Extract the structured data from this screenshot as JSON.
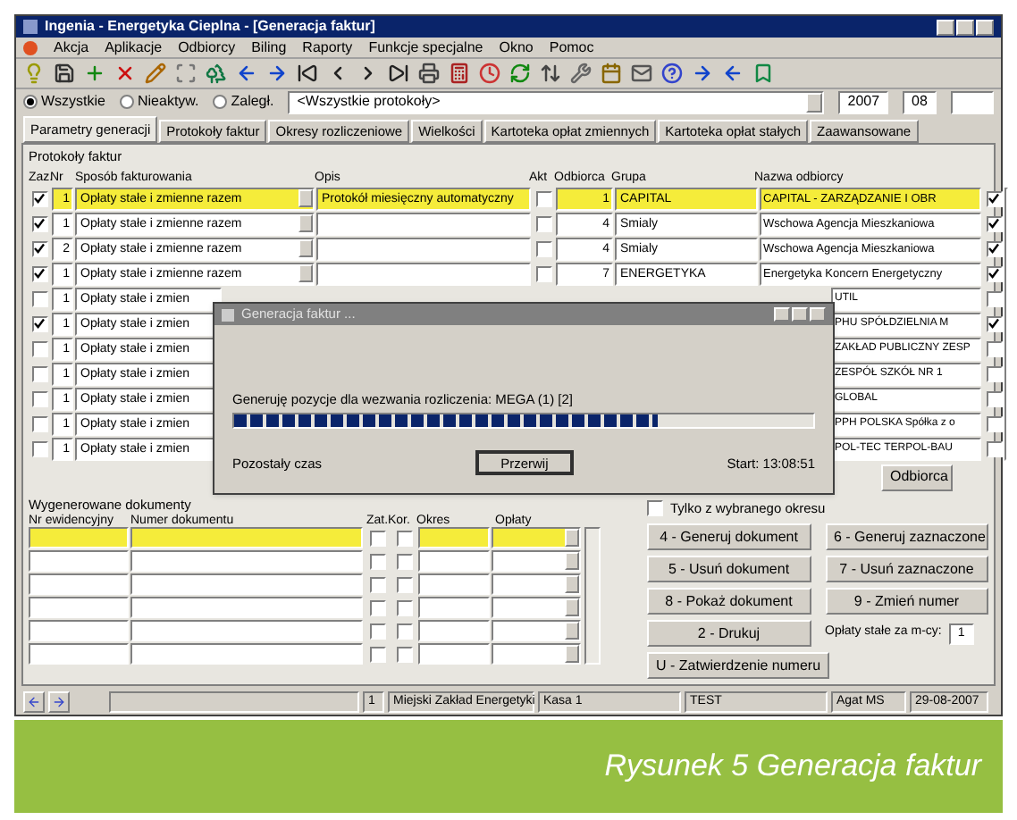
{
  "window": {
    "title": "Ingenia - Energetyka Cieplna - [Generacja faktur]"
  },
  "menu": [
    "Akcja",
    "Aplikacje",
    "Odbiorcy",
    "Biling",
    "Raporty",
    "Funkcje specjalne",
    "Okno",
    "Pomoc"
  ],
  "filter": {
    "options": [
      {
        "label": "Wszystkie",
        "selected": true
      },
      {
        "label": "Nieaktyw.",
        "selected": false
      },
      {
        "label": "Zaległ.",
        "selected": false
      }
    ],
    "group": "<Wszystkie protokoły>",
    "year": "2007",
    "month": "08"
  },
  "tabs": [
    {
      "label": "Parametry generacji",
      "selected": true
    },
    {
      "label": "Protokoły faktur",
      "selected": false
    },
    {
      "label": "Okresy rozliczeniowe",
      "selected": false
    },
    {
      "label": "Wielkości",
      "selected": false
    },
    {
      "label": "Kartoteka opłat zmiennych",
      "selected": false
    },
    {
      "label": "Kartoteka opłat stałych",
      "selected": false
    },
    {
      "label": "Zaawansowane",
      "selected": false
    }
  ],
  "protocols": {
    "title": "Protokoły faktur",
    "columns": [
      "Zaz.",
      "Nr",
      "Sposób fakturowania",
      "Opis",
      "Akt",
      "Odbiorca",
      "Grupa",
      "Nazwa odbiorcy"
    ],
    "rows": [
      {
        "selected": true,
        "checked": true,
        "nr": "1",
        "method": "Opłaty stałe i zmienne razem",
        "description": "Protokół miesięczny automatyczny",
        "active": false,
        "customer_no": "1",
        "group": "CAPITAL",
        "customer": "CAPITAL - ZARZĄDZANIE I OBR",
        "included": true
      },
      {
        "selected": false,
        "checked": true,
        "nr": "1",
        "method": "Opłaty stałe i zmienne razem",
        "description": "",
        "active": false,
        "customer_no": "4",
        "group": "Smialy",
        "customer": "Wschowa Agencja Mieszkaniowa",
        "included": true
      },
      {
        "selected": false,
        "checked": true,
        "nr": "2",
        "method": "Opłaty stałe i zmienne razem",
        "description": "",
        "active": false,
        "customer_no": "4",
        "group": "Smialy",
        "customer": "Wschowa Agencja Mieszkaniowa",
        "included": true
      },
      {
        "selected": false,
        "checked": true,
        "nr": "1",
        "method": "Opłaty stałe i zmienne razem",
        "description": "",
        "active": false,
        "customer_no": "7",
        "group": "ENERGETYKA",
        "customer": "Energetyka Koncern Energetyczny",
        "included": true
      },
      {
        "selected": false,
        "checked": false,
        "nr": "1",
        "method": "Opłaty stałe i zmien",
        "customer": "UTIL",
        "included": false
      },
      {
        "selected": false,
        "checked": true,
        "nr": "1",
        "method": "Opłaty stałe i zmien",
        "customer": "PHU SPÓŁDZIELNIA M",
        "included": true
      },
      {
        "selected": false,
        "checked": false,
        "nr": "1",
        "method": "Opłaty stałe i zmien",
        "customer": "ZAKŁAD PUBLICZNY ZESP",
        "included": false
      },
      {
        "selected": false,
        "checked": false,
        "nr": "1",
        "method": "Opłaty stałe i zmien",
        "customer": "ZESPÓŁ SZKÓŁ NR 1",
        "included": false
      },
      {
        "selected": false,
        "checked": false,
        "nr": "1",
        "method": "Opłaty stałe i zmien",
        "customer": "GLOBAL",
        "included": false
      },
      {
        "selected": false,
        "checked": false,
        "nr": "1",
        "method": "Opłaty stałe i zmien",
        "customer": "PPH POLSKA Spółka z o",
        "included": false
      },
      {
        "selected": false,
        "checked": false,
        "nr": "1",
        "method": "Opłaty stałe i zmien",
        "customer": "POL-TEC TERPOL-BAU",
        "included": false
      }
    ],
    "side_button": "Odbiorca"
  },
  "progress_dialog": {
    "title": "Generacja faktur ...",
    "message": "Generuję pozycje dla wezwania rozliczenia: MEGA (1) [2]",
    "level": 0.73,
    "remaining": "Pozostały czas",
    "button": "Przerwij",
    "start": "Start: 13:08:51"
  },
  "documents": {
    "title": "Wygenerowane dokumenty",
    "columns": [
      "Nr ewidencyjny",
      "Numer dokumentu",
      "Zat.",
      "Kor.",
      "Okres",
      "Opłaty"
    ],
    "rows": [
      {
        "selected": true
      },
      {
        "selected": false
      },
      {
        "selected": false
      },
      {
        "selected": false
      },
      {
        "selected": false
      },
      {
        "selected": false
      }
    ]
  },
  "document_actions": {
    "only_period": {
      "label": "Tylko z wybranego okresu",
      "checked": false
    },
    "buttons": [
      "4 - Generuj dokument",
      "6 - Generuj zaznaczone",
      "5 - Usuń dokument",
      "7 - Usuń zaznaczone",
      "8 - Pokaż dokument",
      "9 - Zmień numer",
      "2 - Drukuj"
    ],
    "fee_label": "Opłaty stałe za m-cy:",
    "fee_value": "1",
    "confirm_button": "U - Zatwierdzenie numeru"
  },
  "status_bar": [
    "1",
    "Miejski Zakład Energetyki",
    "Kasa 1",
    "TEST",
    "Agat MS",
    "29-08-2007"
  ],
  "caption": "Rysunek 5 Generacja faktur"
}
